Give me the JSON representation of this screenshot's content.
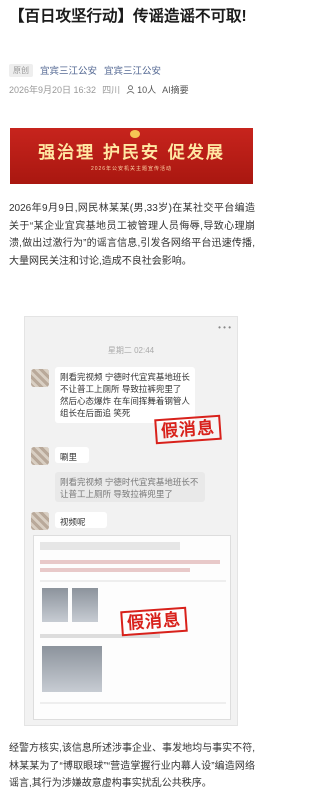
{
  "article": {
    "title": "【百日攻坚行动】传谣造谣不可取!",
    "source_tag": "原创",
    "source_name_1": "宜宾三江公安",
    "source_name_2": "宜宾三江公安",
    "date": "2026年9月20日 16:32",
    "region": "四川",
    "readers": "10人",
    "ai_summary": "AI摘要"
  },
  "banner": {
    "slogan": "强治理 护民安 促发展",
    "subtitle": "2026年公安机关主题宣传活动"
  },
  "paragraphs": {
    "p1": "2026年9月9日,网民林某某(男,33岁)在某社交平台编造关于“某企业宜宾基地员工被管理人员侮辱,导致心理崩溃,做出过激行为”的谣言信息,引发各网络平台迅速传播,大量网民关注和讨论,造成不良社会影响。",
    "p2": "经警方核实,该信息所述涉事企业、事发地均与事实不符,林某某为了“博取眼球”“营造掌握行业内幕人设”编造网络谣言,其行为涉嫌故意虚构事实扰乱公共秩序。"
  },
  "chat": {
    "time": "星期二 02:44",
    "msg1": "刚看完视频 宁德时代宜宾基地班长不让普工上厕所 导致拉裤兜里了 然后心态爆炸 在车间挥舞着钢管人 组长在后面追 笑死",
    "msg2": "唰里",
    "msg3": "刚看完视频 宁德时代宜宾基地班长不让普工上厕所 导致拉裤兜里了",
    "msg4": "视频呢",
    "stamp": "假消息"
  }
}
